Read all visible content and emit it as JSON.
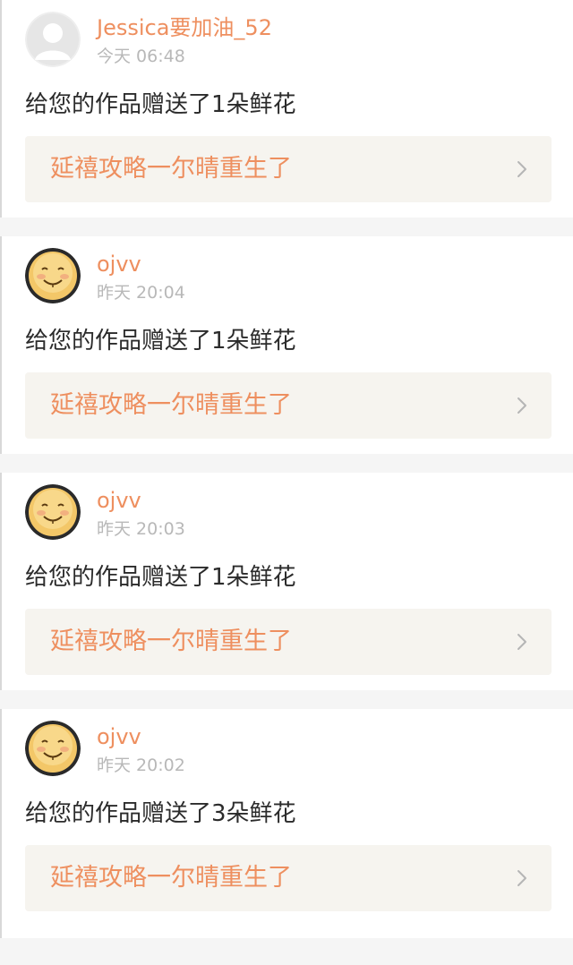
{
  "colors": {
    "accent": "#ee8f5f",
    "time_text": "#b8b8b8",
    "body_text": "#2b2b2b",
    "link_bg": "#f6f4ef",
    "separator": "#f5f5f5"
  },
  "notifications": [
    {
      "username": "Jessica要加油_52",
      "time": "今天 06:48",
      "message": "给您的作品赠送了1朵鲜花",
      "work_title": "延禧攻略一尔晴重生了",
      "avatar": "default-avatar",
      "link_icon": "chevron-right-icon"
    },
    {
      "username": "ojvv",
      "time": "昨天 20:04",
      "message": "给您的作品赠送了1朵鲜花",
      "work_title": "延禧攻略一尔晴重生了",
      "avatar": "smiley-avatar",
      "link_icon": "chevron-right-icon"
    },
    {
      "username": "ojvv",
      "time": "昨天 20:03",
      "message": "给您的作品赠送了1朵鲜花",
      "work_title": "延禧攻略一尔晴重生了",
      "avatar": "smiley-avatar",
      "link_icon": "chevron-right-icon"
    },
    {
      "username": "ojvv",
      "time": "昨天 20:02",
      "message": "给您的作品赠送了3朵鲜花",
      "work_title": "延禧攻略一尔晴重生了",
      "avatar": "smiley-avatar",
      "link_icon": "chevron-right-icon"
    }
  ]
}
